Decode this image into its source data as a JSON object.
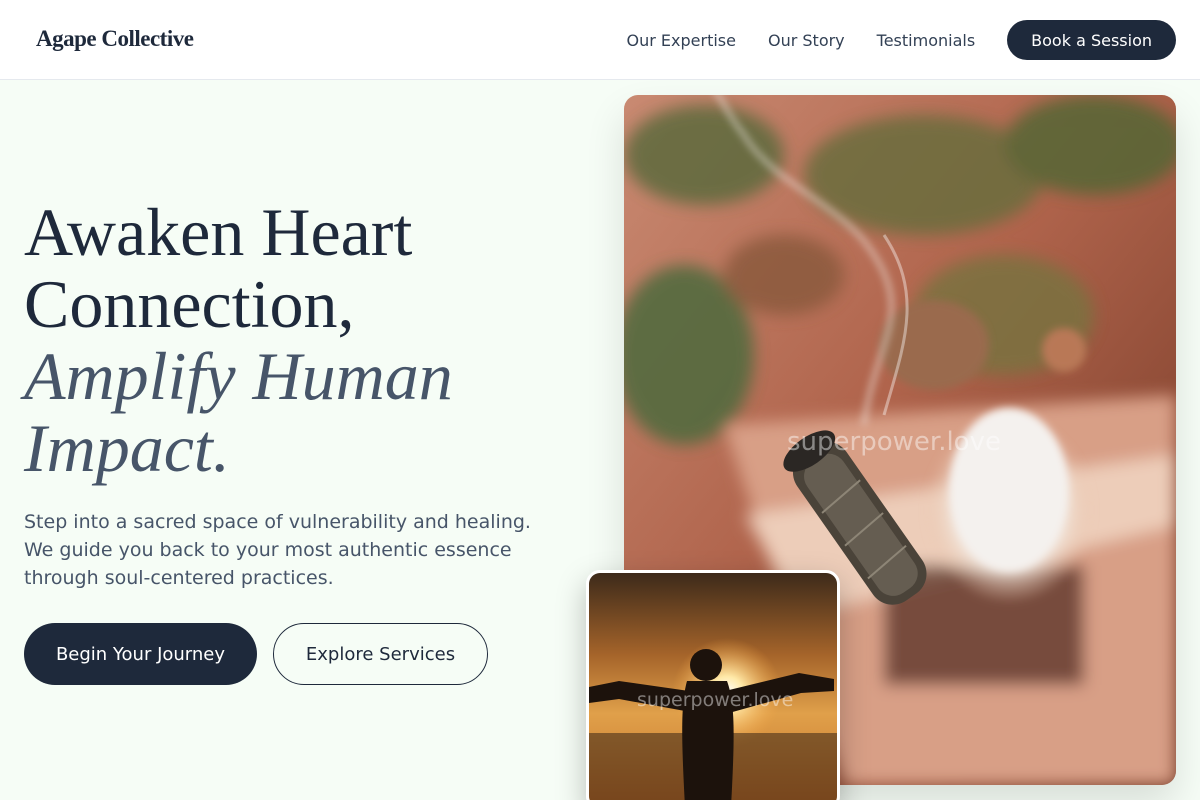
{
  "header": {
    "logo": "Agape Collective",
    "nav": [
      "Our Expertise",
      "Our Story",
      "Testimonials"
    ],
    "cta": "Book a Session"
  },
  "hero": {
    "headline_line1": "Awaken Heart",
    "headline_line2": "Connection,",
    "headline_accent_line1": "Amplify Human",
    "headline_accent_line2": "Impact.",
    "subtext": "Step into a sacred space of vulnerability and healing. We guide you back to your most authentic essence through soul-centered practices.",
    "primary_button": "Begin Your Journey",
    "secondary_button": "Explore Services"
  },
  "images": {
    "main_alt": "Burning sage bundle with smoke near a salt lamp and plants",
    "main_watermark": "superpower.love",
    "small_alt": "Silhouette of a person with open arms at sunset",
    "small_watermark": "superpower.love"
  },
  "colors": {
    "primary": "#1e293b",
    "accent_text": "#475569",
    "background": "#f6fdf6"
  }
}
